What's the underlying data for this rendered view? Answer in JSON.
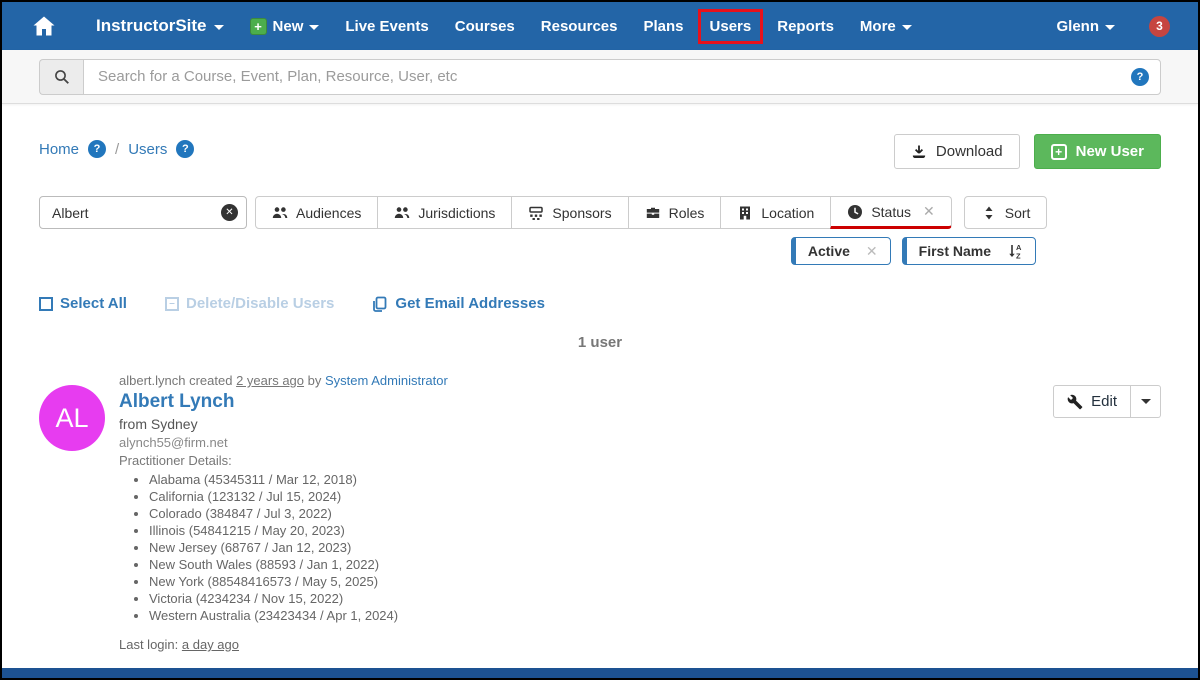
{
  "nav": {
    "brand": "InstructorSite",
    "new_label": "New",
    "items": [
      {
        "label": "Live Events"
      },
      {
        "label": "Courses"
      },
      {
        "label": "Resources"
      },
      {
        "label": "Plans"
      },
      {
        "label": "Users",
        "highlighted": true
      },
      {
        "label": "Reports"
      },
      {
        "label": "More"
      }
    ],
    "user_menu": "Glenn",
    "notification_count": "3"
  },
  "search": {
    "placeholder": "Search for a Course, Event, Plan, Resource, User, etc"
  },
  "breadcrumb": {
    "home": "Home",
    "separator": "/",
    "current": "Users"
  },
  "toolbar": {
    "download_label": "Download",
    "new_user_label": "New User"
  },
  "filters": {
    "search_value": "Albert",
    "buttons": [
      "Audiences",
      "Jurisdictions",
      "Sponsors",
      "Roles",
      "Location",
      "Status"
    ],
    "sort_label": "Sort",
    "active_chip": "Active",
    "sort_chip": "First Name"
  },
  "actions": {
    "select_all": "Select All",
    "delete_disable": "Delete/Disable Users",
    "get_emails": "Get Email Addresses"
  },
  "results": {
    "count_text": "1 user"
  },
  "user": {
    "initials": "AL",
    "meta_prefix": "albert.lynch created",
    "meta_time": "2 years ago",
    "meta_by": "by",
    "meta_admin": "System Administrator",
    "name": "Albert Lynch",
    "location": "from Sydney",
    "email": "alynch55@firm.net",
    "details_label": "Practitioner Details:",
    "practitioner_details": [
      "Alabama (45345311 / Mar 12, 2018)",
      "California (123132 / Jul 15, 2024)",
      "Colorado (384847 / Jul 3, 2022)",
      "Illinois (54841215 / May 20, 2023)",
      "New Jersey (68767 / Jan 12, 2023)",
      "New South Wales (88593 / Jan 1, 2022)",
      "New York (88548416573 / May 5, 2025)",
      "Victoria (4234234 / Nov 15, 2022)",
      "Western Australia (23423434 / Apr 1, 2024)"
    ],
    "last_login_label": "Last login:",
    "last_login_value": "a day ago",
    "edit_label": "Edit"
  },
  "colors": {
    "navbar": "#2365a7",
    "annotation_red": "#e8121c",
    "badge_red": "#c64540",
    "link_blue": "#337ab7",
    "green": "#5cb85c",
    "avatar_pink": "#e73cf0",
    "status_underline": "#cc0000",
    "footer_blue": "#1d5292"
  }
}
